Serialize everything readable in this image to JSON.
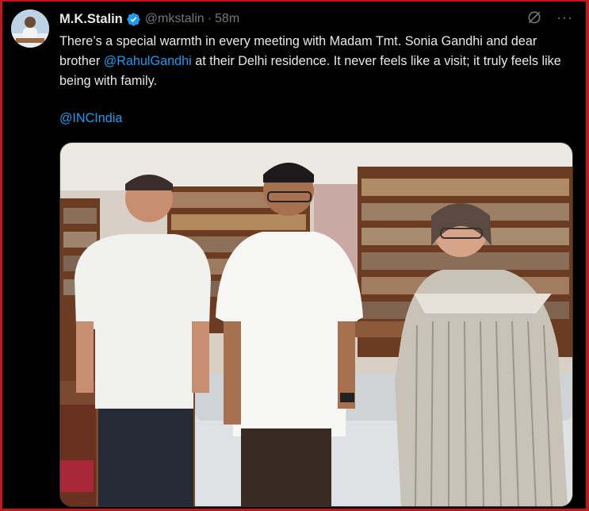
{
  "author": {
    "name": "M.K.Stalin",
    "handle": "@mkstalin",
    "separator": "·",
    "time": "58m"
  },
  "tweet": {
    "text_part1": "There’s a special warmth in every meeting with Madam Tmt. Sonia Gandhi and dear brother ",
    "mention": "@RahulGandhi",
    "text_part2": " at their Delhi residence. It never feels like a visit; it truly feels like being with family.",
    "tag": "@INCIndia"
  },
  "icons": {
    "verified": "verified-badge-icon",
    "grok": "grok-icon",
    "more": "more-options-icon"
  },
  "colors": {
    "link": "#1d9bf0",
    "muted": "#71767b",
    "text": "#e7e9ea",
    "background": "#000000",
    "border_highlight": "#c01818"
  },
  "more_glyph": "···"
}
